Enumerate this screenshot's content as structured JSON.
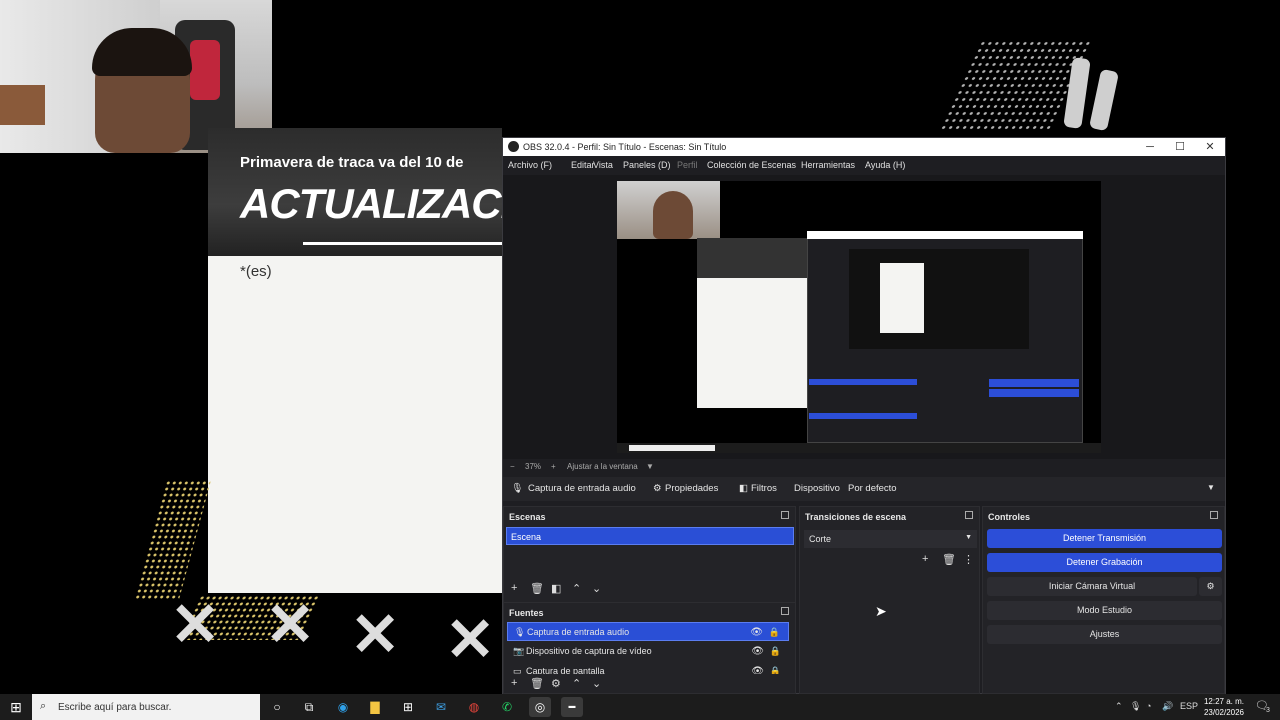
{
  "background": {
    "doc_title": "Primavera de traca va del 10 de",
    "doc_big_text": "ACTUALIZACION",
    "doc_body": "*(es)"
  },
  "obs": {
    "title": "OBS 32.0.4 - Perfil: Sin Título - Escenas: Sin Título",
    "menu": [
      "Archivo (F)",
      "Editar",
      "Vista",
      "Paneles (D)",
      "Perfil",
      "Colección de Escenas",
      "Herramientas",
      "Ayuda (H)"
    ],
    "zoom": {
      "minus": "−",
      "value": "37%",
      "plus": "+",
      "fit": "Ajustar a la ventana"
    },
    "source_bar": {
      "source": "Captura de entrada audio",
      "properties": "Propiedades",
      "filters": "Filtros",
      "device_label": "Dispositivo",
      "device_value": "Por defecto"
    },
    "scenes": {
      "title": "Escenas",
      "items": [
        "Escena"
      ]
    },
    "sources": {
      "title": "Fuentes",
      "items": [
        {
          "label": "Captura de entrada audio",
          "icon": "microphone-icon"
        },
        {
          "label": "Dispositivo de captura de vídeo",
          "icon": "camera-icon"
        },
        {
          "label": "Captura de pantalla",
          "icon": "monitor-icon"
        }
      ]
    },
    "transitions": {
      "title": "Transiciones de escena",
      "selected": "Corte"
    },
    "controls": {
      "title": "Controles",
      "stop_stream": "Detener Transmisión",
      "stop_record": "Detener Grabación",
      "virtual_cam": "Iniciar Cámara Virtual",
      "studio_mode": "Modo Estudio",
      "settings": "Ajustes"
    }
  },
  "taskbar": {
    "search_placeholder": "Escribe aquí para buscar.",
    "lang": "ESP",
    "time": "12:27 a. m.",
    "date": "23/02/2026",
    "notifications": "3"
  },
  "colors": {
    "accent": "#2c4ed8",
    "obs_bg": "#1e1e22",
    "taskbar": "#1c1c1c"
  }
}
